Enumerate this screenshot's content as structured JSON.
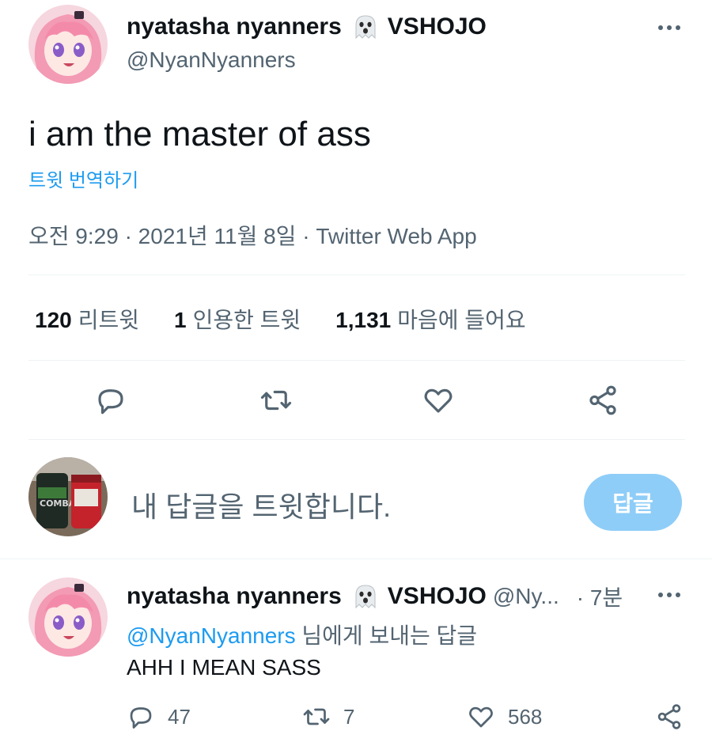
{
  "tweet": {
    "author": {
      "display_name": "nyatasha nyanners",
      "affiliation": "VSHOJO",
      "handle": "@NyanNyanners"
    },
    "text": "i am the master of ass",
    "translate_link": "트윗 번역하기",
    "meta": "오전 9:29 · 2021년 11월 8일 · Twitter Web App",
    "stats": {
      "retweets_count": "120",
      "retweets_label": "리트윗",
      "quotes_count": "1",
      "quotes_label": "인용한 트윗",
      "likes_count": "1,131",
      "likes_label": "마음에 들어요"
    }
  },
  "compose": {
    "placeholder": "내 답글을 트윗합니다.",
    "button_label": "답글"
  },
  "reply": {
    "display_name": "nyatasha nyanners",
    "affiliation": "VSHOJO",
    "handle_truncated": "@Ny...",
    "time": "· 7분",
    "replying_to_mention": "@NyanNyanners",
    "replying_to_suffix": " 님에게 보내는 답글",
    "text": "AHH I MEAN SASS",
    "counts": {
      "replies": "47",
      "retweets": "7",
      "likes": "568"
    }
  },
  "icons": {
    "author_emoji": "ghost-emoji",
    "more": "ellipsis-icon",
    "reply": "reply-icon",
    "retweet": "retweet-icon",
    "like": "heart-icon",
    "share": "share-icon"
  },
  "colors": {
    "text_primary": "#0f1419",
    "text_secondary": "#536471",
    "link": "#1d9bf0",
    "button_disabled": "#8ecdf8",
    "divider": "#eff3f4"
  }
}
